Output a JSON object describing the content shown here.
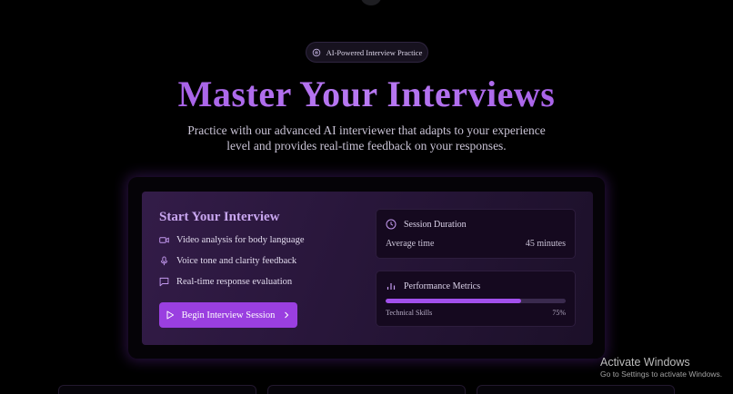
{
  "badge": {
    "icon": "brain-icon",
    "label": "AI-Powered Interview Practice"
  },
  "hero": {
    "title": "Master Your Interviews",
    "subtitle": "Practice with our advanced AI interviewer that adapts to your experience level and provides real-time feedback on your responses."
  },
  "start": {
    "title": "Start Your Interview",
    "features": [
      {
        "icon": "video-icon",
        "label": "Video analysis for body language"
      },
      {
        "icon": "mic-icon",
        "label": "Voice tone and clarity feedback"
      },
      {
        "icon": "chat-icon",
        "label": "Real-time response evaluation"
      }
    ],
    "button_label": "Begin Interview Session"
  },
  "session": {
    "title": "Session Duration",
    "label": "Average time",
    "value": "45 minutes"
  },
  "metrics": {
    "title": "Performance Metrics",
    "label": "Technical Skills",
    "value": "75%",
    "progress": 0.75
  },
  "windows": {
    "title": "Activate Windows",
    "subtitle": "Go to Settings to activate Windows."
  },
  "colors": {
    "accent": "#9a3fe0",
    "title_gradient": [
      "#9b4fe0",
      "#b879f2"
    ],
    "background": "#000000"
  }
}
